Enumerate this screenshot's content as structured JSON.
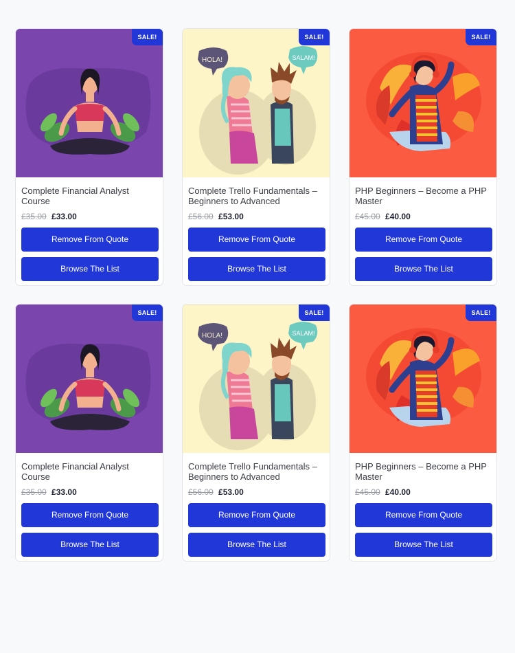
{
  "colors": {
    "accent": "#2137d8",
    "page_bg": "#f8f9fb"
  },
  "cards": [
    {
      "image_icon": "yoga-meditation-illustration",
      "image_bg": "#7a45ad",
      "badge": "SALE!",
      "title": "Complete Financial Analyst Course",
      "old_price": "£35.00",
      "new_price": "£33.00",
      "remove_label": "Remove From Quote",
      "browse_label": "Browse The List"
    },
    {
      "image_icon": "conversation-hola-salam-illustration",
      "image_bg": "#fdf5c7",
      "image_text_left": "HOLA!",
      "image_text_right": "SALAM!",
      "badge": "SALE!",
      "title": "Complete Trello Fundamentals – Beginners to Advanced",
      "old_price": "£56.00",
      "new_price": "£53.00",
      "remove_label": "Remove From Quote",
      "browse_label": "Browse The List"
    },
    {
      "image_icon": "music-headphones-illustration",
      "image_bg": "#fb5b40",
      "badge": "SALE!",
      "title": "PHP Beginners – Become a PHP Master",
      "old_price": "£45.00",
      "new_price": "£40.00",
      "remove_label": "Remove From Quote",
      "browse_label": "Browse The List"
    },
    {
      "image_icon": "yoga-meditation-illustration",
      "image_bg": "#7a45ad",
      "badge": "SALE!",
      "title": "Complete Financial Analyst Course",
      "old_price": "£35.00",
      "new_price": "£33.00",
      "remove_label": "Remove From Quote",
      "browse_label": "Browse The List"
    },
    {
      "image_icon": "conversation-hola-salam-illustration",
      "image_bg": "#fdf5c7",
      "image_text_left": "HOLA!",
      "image_text_right": "SALAM!",
      "badge": "SALE!",
      "title": "Complete Trello Fundamentals – Beginners to Advanced",
      "old_price": "£56.00",
      "new_price": "£53.00",
      "remove_label": "Remove From Quote",
      "browse_label": "Browse The List"
    },
    {
      "image_icon": "music-headphones-illustration",
      "image_bg": "#fb5b40",
      "badge": "SALE!",
      "title": "PHP Beginners – Become a PHP Master",
      "old_price": "£45.00",
      "new_price": "£40.00",
      "remove_label": "Remove From Quote",
      "browse_label": "Browse The List"
    }
  ]
}
